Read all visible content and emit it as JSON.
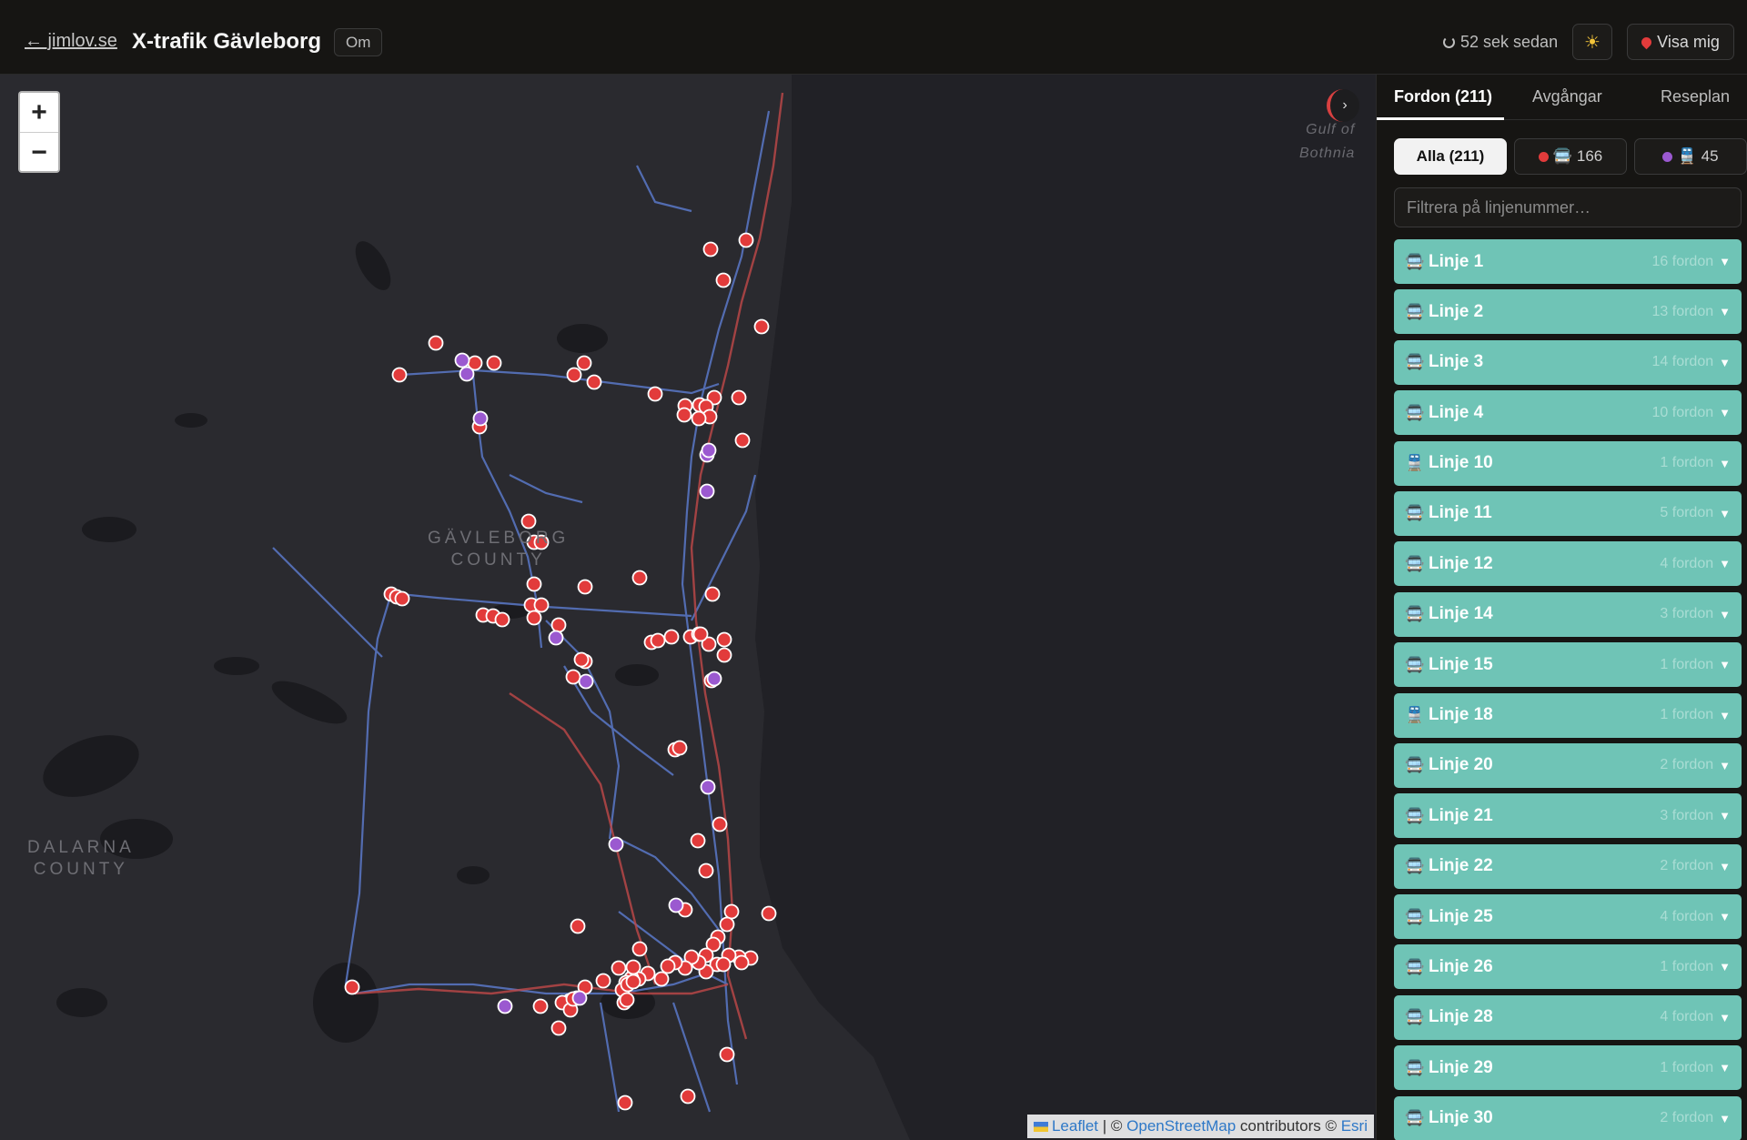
{
  "header": {
    "back_link": "← jimlov.se",
    "title": "X-trafik Gävleborg",
    "about_label": "Om",
    "updated_text": "52 sek sedan",
    "theme_icon": "sun-icon",
    "locate_label": "Visa mig"
  },
  "map": {
    "labels": {
      "gavleborg_line1": "GÄVLEBORG",
      "gavleborg_line2": "COUNTY",
      "dalarna_line1": "DALARNA",
      "dalarna_line2": "COUNTY",
      "gulf_line1": "Gulf of",
      "gulf_line2": "Bothnia"
    },
    "zoom_in": "+",
    "zoom_out": "−",
    "expand": "›",
    "attribution": {
      "leaflet": "Leaflet",
      "sep": "| ©",
      "osm": "OpenStreetMap",
      "contributors": "contributors ©",
      "esri": "Esri"
    },
    "colors": {
      "bus": "#e23b3b",
      "train": "#9b59d0"
    }
  },
  "sidebar": {
    "tabs": [
      {
        "label": "Fordon (211)"
      },
      {
        "label": "Avgångar"
      },
      {
        "label": "Reseplan"
      }
    ],
    "filters": {
      "all": "Alla (211)",
      "bus_count": "166",
      "train_count": "45"
    },
    "filter_placeholder": "Filtrera på linjenummer…",
    "lines": [
      {
        "icon": "🚍",
        "label": "Linje 1",
        "count": "16 fordon"
      },
      {
        "icon": "🚍",
        "label": "Linje 2",
        "count": "13 fordon"
      },
      {
        "icon": "🚍",
        "label": "Linje 3",
        "count": "14 fordon"
      },
      {
        "icon": "🚍",
        "label": "Linje 4",
        "count": "10 fordon"
      },
      {
        "icon": "🚆",
        "label": "Linje 10",
        "count": "1 fordon"
      },
      {
        "icon": "🚍",
        "label": "Linje 11",
        "count": "5 fordon"
      },
      {
        "icon": "🚍",
        "label": "Linje 12",
        "count": "4 fordon"
      },
      {
        "icon": "🚍",
        "label": "Linje 14",
        "count": "3 fordon"
      },
      {
        "icon": "🚍",
        "label": "Linje 15",
        "count": "1 fordon"
      },
      {
        "icon": "🚆",
        "label": "Linje 18",
        "count": "1 fordon"
      },
      {
        "icon": "🚍",
        "label": "Linje 20",
        "count": "2 fordon"
      },
      {
        "icon": "🚍",
        "label": "Linje 21",
        "count": "3 fordon"
      },
      {
        "icon": "🚍",
        "label": "Linje 22",
        "count": "2 fordon"
      },
      {
        "icon": "🚍",
        "label": "Linje 25",
        "count": "4 fordon"
      },
      {
        "icon": "🚍",
        "label": "Linje 26",
        "count": "1 fordon"
      },
      {
        "icon": "🚍",
        "label": "Linje 28",
        "count": "4 fordon"
      },
      {
        "icon": "🚍",
        "label": "Linje 29",
        "count": "1 fordon"
      },
      {
        "icon": "🚍",
        "label": "Linje 30",
        "count": "2 fordon"
      }
    ]
  }
}
